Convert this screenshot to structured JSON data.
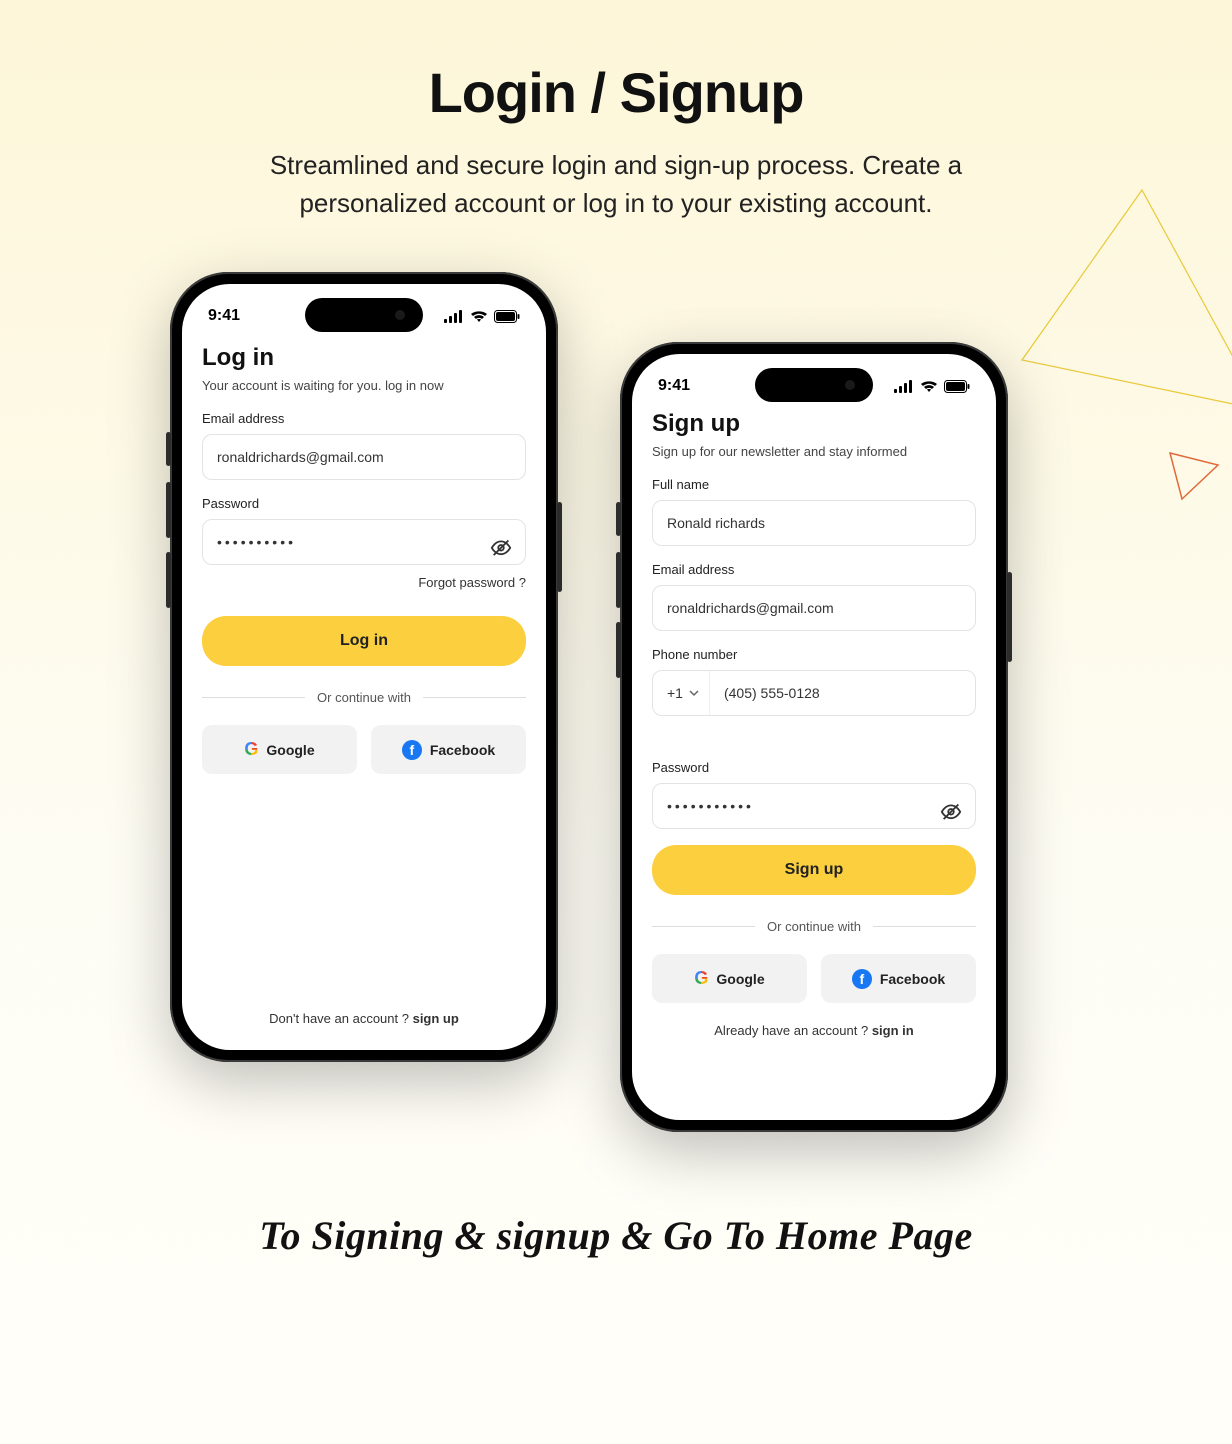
{
  "page": {
    "title": "Login / Signup",
    "subtitle": "Streamlined and secure login and sign-up process. Create a personalized account or log in to your existing account.",
    "caption": "To Signing & signup & Go To Home Page"
  },
  "status": {
    "time": "9:41"
  },
  "colors": {
    "accent": "#fccf3e",
    "facebook": "#1877f2"
  },
  "login": {
    "heading": "Log in",
    "sub": "Your account is waiting for you. log in now",
    "email_label": "Email address",
    "email_value": "ronaldrichards@gmail.com",
    "password_label": "Password",
    "password_value": "••••••••••",
    "forgot": "Forgot password ?",
    "submit": "Log in",
    "divider": "Or continue with",
    "google": "Google",
    "facebook": "Facebook",
    "footer_text": "Don't have an account ? ",
    "footer_action": "sign up"
  },
  "signup": {
    "heading": "Sign up",
    "sub": "Sign up for our newsletter and stay informed",
    "name_label": "Full name",
    "name_value": "Ronald richards",
    "email_label": "Email address",
    "email_value": "ronaldrichards@gmail.com",
    "phone_label": "Phone number",
    "country_code": "+1",
    "phone_value": "(405) 555-0128",
    "password_label": "Password",
    "password_value": "•••••••••••",
    "submit": "Sign up",
    "divider": "Or continue with",
    "google": "Google",
    "facebook": "Facebook",
    "footer_text": "Already have an account ? ",
    "footer_action": "sign in"
  }
}
